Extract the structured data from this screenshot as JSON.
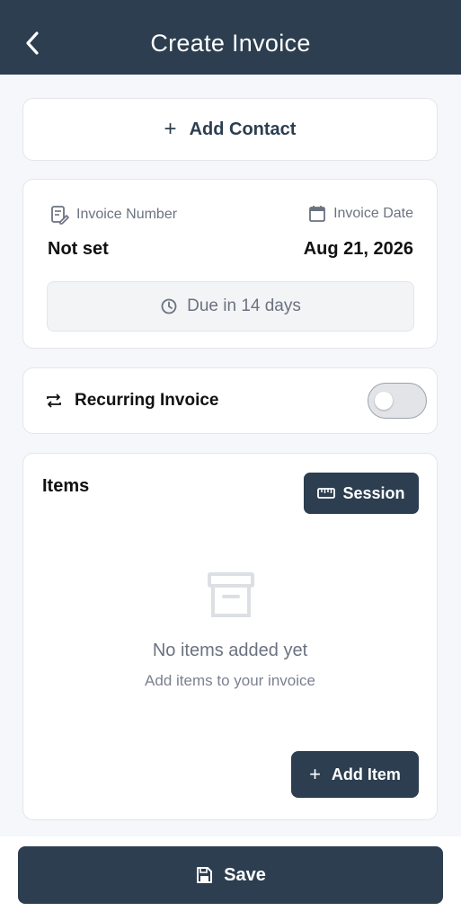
{
  "header": {
    "title": "Create Invoice",
    "back_icon": "chevron-left-icon"
  },
  "contact": {
    "add_label": "Add Contact",
    "icon": "plus-icon"
  },
  "invoice": {
    "number_label": "Invoice Number",
    "number_value": "Not set",
    "date_label": "Invoice Date",
    "date_value": "Aug 21, 2026",
    "due_label": "Due in 14 days"
  },
  "recurring": {
    "label": "Recurring Invoice",
    "enabled": false
  },
  "items": {
    "title": "Items",
    "session_label": "Session",
    "empty_title": "No items added yet",
    "empty_subtitle": "Add items to your invoice",
    "add_item_label": "Add Item",
    "list": []
  },
  "footer": {
    "save_label": "Save"
  },
  "colors": {
    "primary": "#2c3e50",
    "background": "#f5f7fa",
    "muted_text": "#6b7280"
  }
}
